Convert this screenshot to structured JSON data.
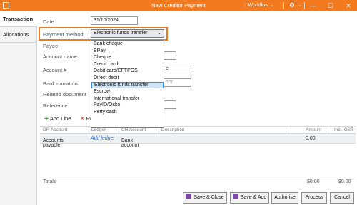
{
  "window": {
    "title": "New Creditor Payment",
    "workflow_label": "Workflow",
    "colors": {
      "accent": "#f47a1f",
      "selection": "#cde4f7"
    }
  },
  "tabs": [
    {
      "label": "Transaction"
    },
    {
      "label": "Allocations"
    }
  ],
  "form": {
    "date_label": "Date",
    "date_value": "31/10/2024",
    "payment_method_label": "Payment method",
    "payment_method_value": "Electronic funds transfer",
    "payee_label": "Payee",
    "account_name_label": "Account name",
    "account_number_label": "Account #",
    "bank_narration_label": "Bank narration",
    "bank_narration_placeholder": "ent",
    "related_document_label": "Related document",
    "reference_label": "Reference",
    "account_number_partial": "e"
  },
  "payment_method_options": [
    "Bank cheque",
    "BPay",
    "Cheque",
    "Credit card",
    "Debit card/EFTPOS",
    "Direct debit",
    "Electronic funds transfer",
    "Escrow",
    "International transfer",
    "PayID/Osko",
    "Petty cash"
  ],
  "lines_toolbar": {
    "add_line": "Add Line",
    "remove_partial": "Re"
  },
  "grid": {
    "headers": {
      "dr_account": "DR Account",
      "ledger": "Ledger",
      "cr_account": "CR Account",
      "description": "Description",
      "amount": "Amount",
      "incl_gst": "Incl. GST"
    },
    "row": {
      "dr_account": "Accounts payable",
      "ledger": "Add ledger",
      "cr_account": "Bank account",
      "amount": "0.00"
    }
  },
  "totals": {
    "label": "Totals",
    "amount": "$0.00",
    "gst": "$0.00"
  },
  "buttons": {
    "save_close": "Save & Close",
    "save_add": "Save & Add",
    "authorise": "Authorise",
    "process": "Process",
    "cancel": "Cancel"
  }
}
